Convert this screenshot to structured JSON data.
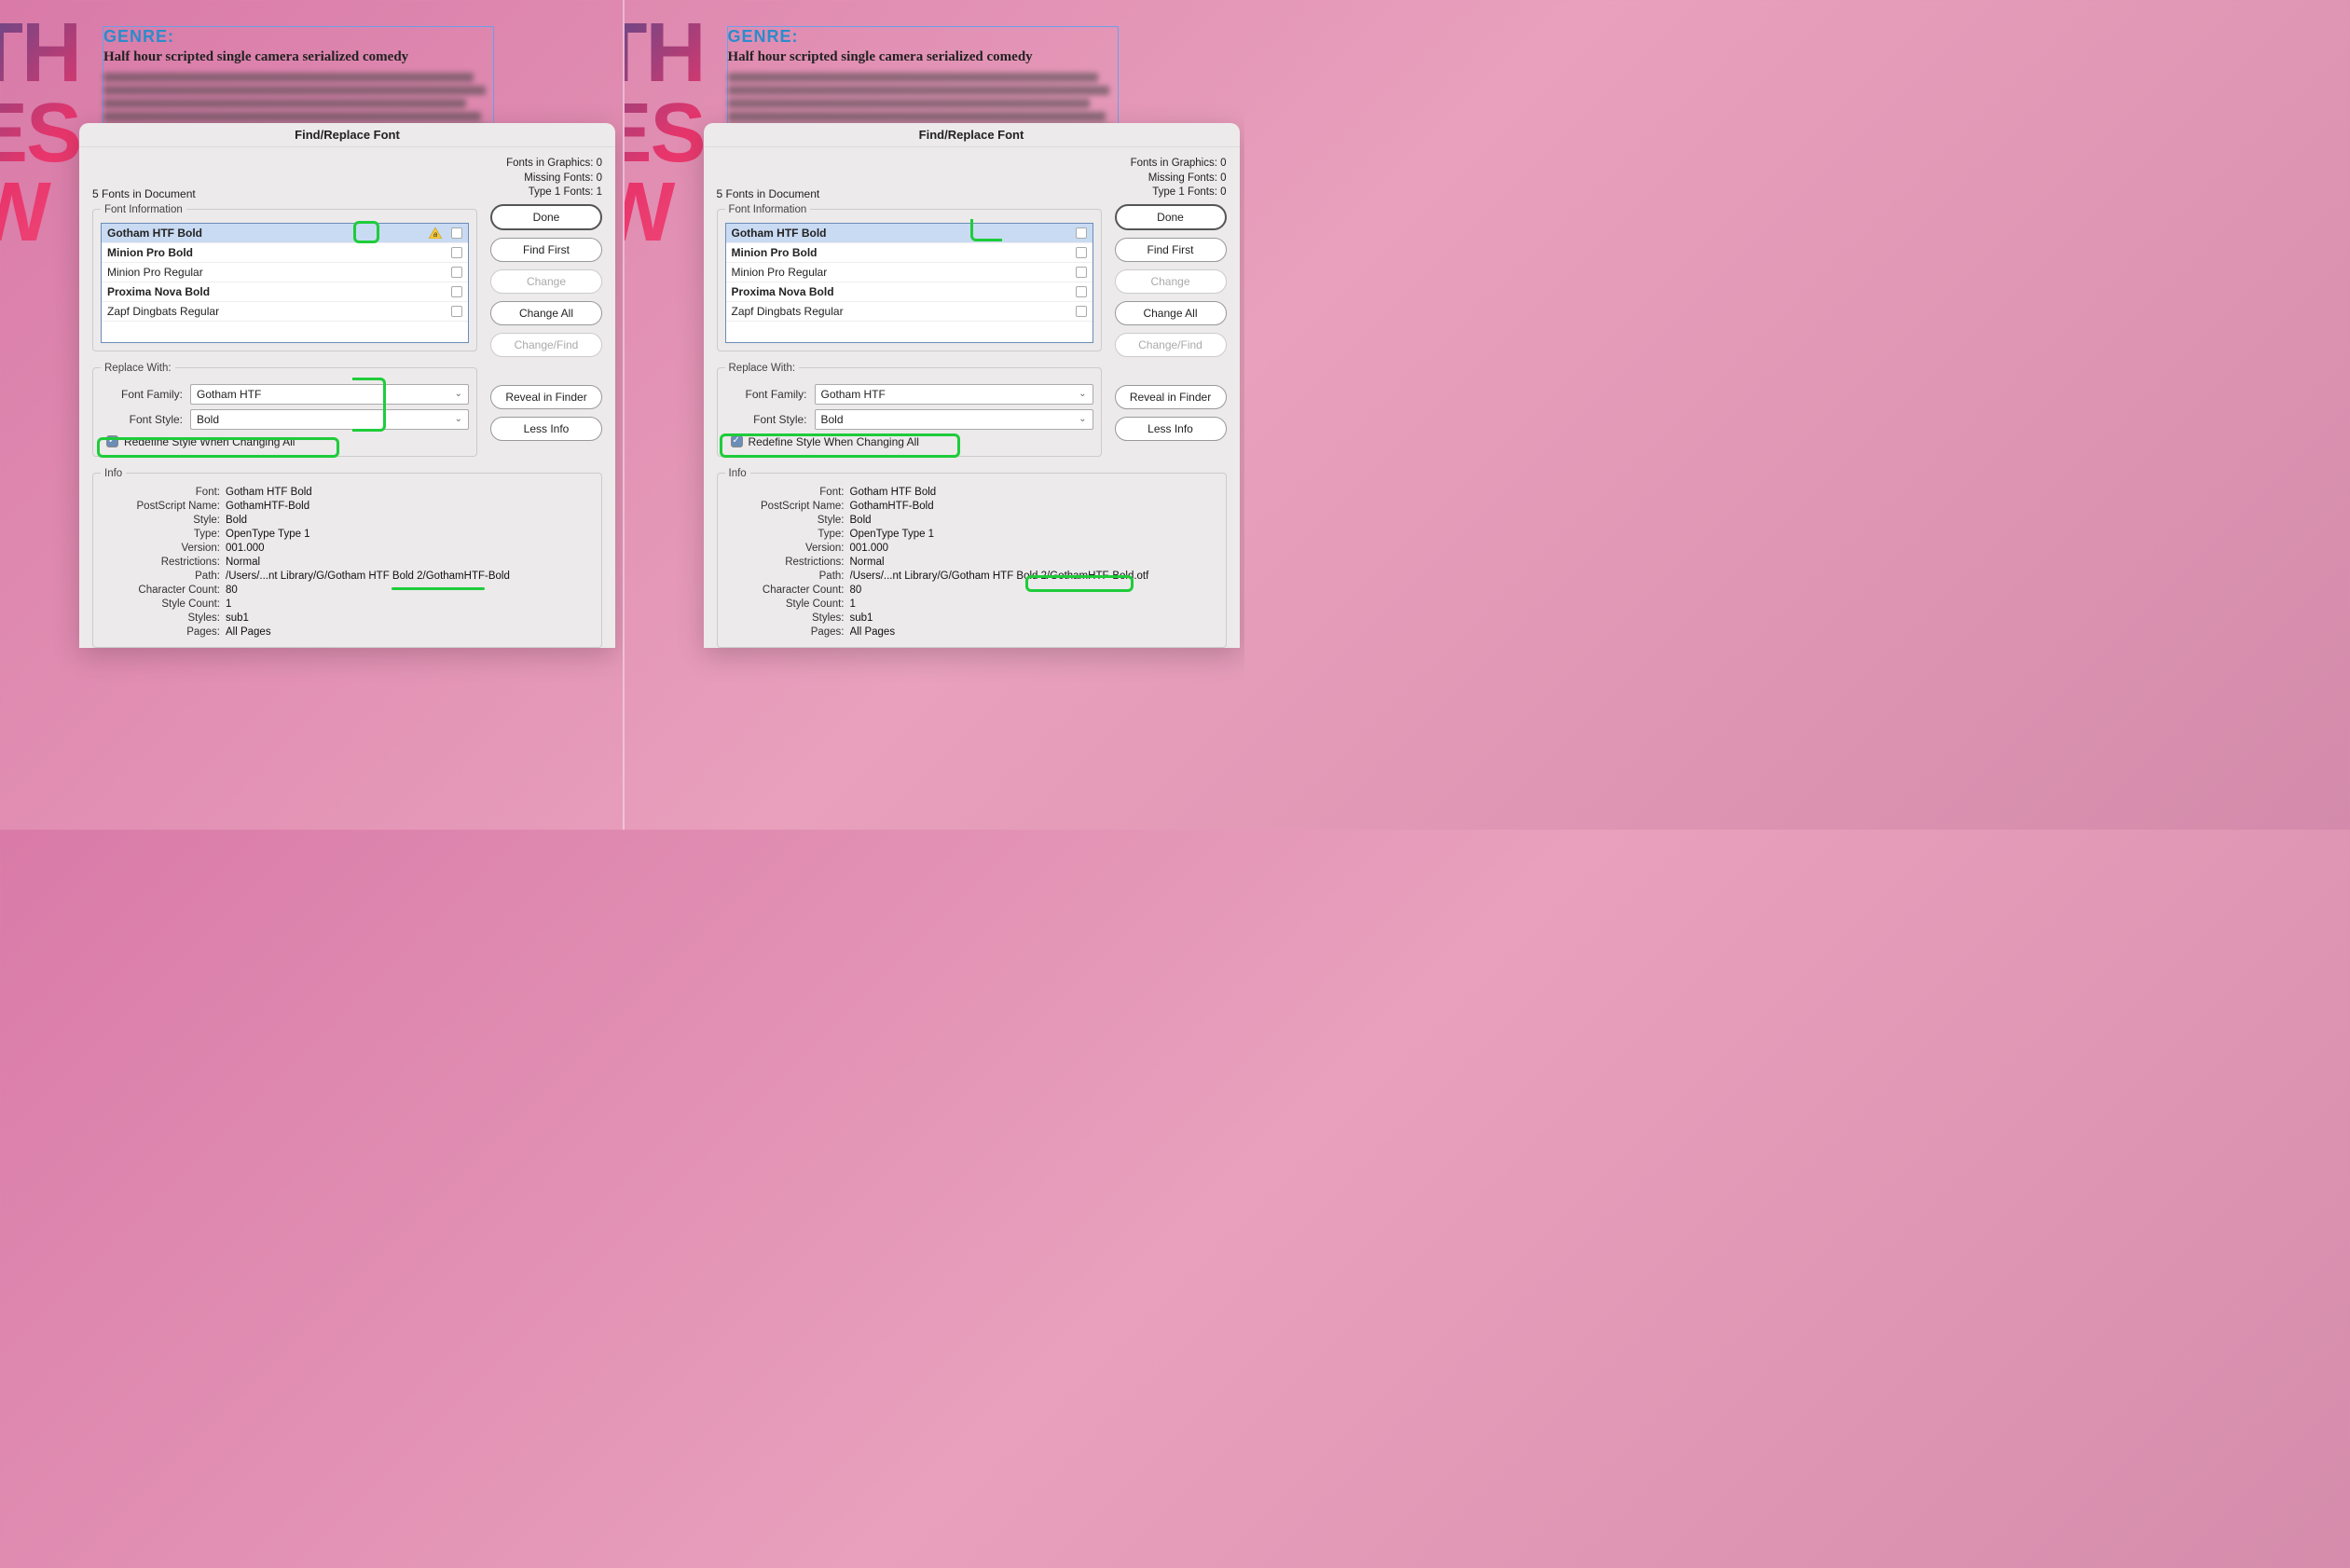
{
  "doc": {
    "big_letters": "TH\nES\nW",
    "genre_label": "GENRE:",
    "genre_text": "Half hour scripted single camera serialized comedy"
  },
  "dialog": {
    "title": "Find/Replace Font",
    "summary": "5 Fonts in Document",
    "stats": {
      "graphics": "Fonts in Graphics: 0",
      "missing": "Missing Fonts: 0",
      "type1_left": "Type 1 Fonts: 1",
      "type1_right": "Type 1 Fonts: 0"
    },
    "font_info_legend": "Font Information",
    "fonts": [
      {
        "name": "Gotham HTF Bold",
        "selected": true,
        "bold": true
      },
      {
        "name": "Minion Pro Bold",
        "bold": true
      },
      {
        "name": "Minion Pro Regular"
      },
      {
        "name": "Proxima Nova Bold",
        "bold": true
      },
      {
        "name": "Zapf Dingbats Regular"
      }
    ],
    "buttons": {
      "done": "Done",
      "find_first": "Find First",
      "change": "Change",
      "change_all": "Change All",
      "change_find": "Change/Find",
      "reveal": "Reveal in Finder",
      "less_info": "Less Info"
    },
    "replace": {
      "legend": "Replace With:",
      "family_label": "Font Family:",
      "family_value": "Gotham HTF",
      "style_label": "Font Style:",
      "style_value": "Bold",
      "redefine": "Redefine Style When Changing All"
    },
    "info": {
      "legend": "Info",
      "rows": {
        "Font": "Gotham HTF Bold",
        "PostScript Name": "GothamHTF-Bold",
        "Style": "Bold",
        "Type": "OpenType Type 1",
        "Version": "001.000",
        "Restrictions": "Normal",
        "Path_left": "/Users/...nt Library/G/Gotham HTF Bold 2/GothamHTF-Bold",
        "Path_right": "/Users/...nt Library/G/Gotham HTF Bold 2/GothamHTF-Bold.otf",
        "Character Count": "80",
        "Style Count": "1",
        "Styles": "sub1",
        "Pages": "All Pages"
      }
    }
  }
}
